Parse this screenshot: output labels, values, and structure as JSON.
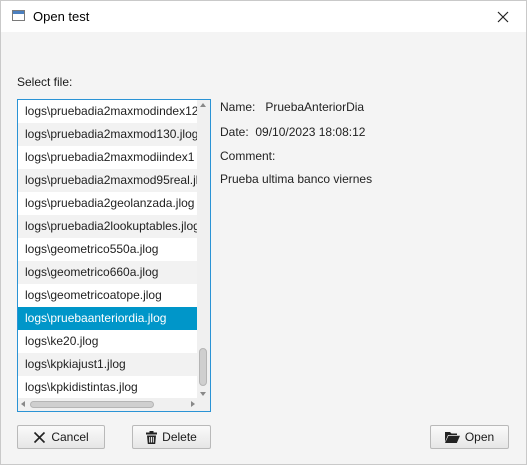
{
  "window": {
    "title": "Open test",
    "icon": "app-window-icon",
    "close_icon": "close-icon"
  },
  "select_label": "Select file:",
  "files": [
    "logs\\pruebadia2maxmodindex12",
    "logs\\pruebadia2maxmod130.jlog",
    "logs\\pruebadia2maxmodiindex1",
    "logs\\pruebadia2maxmod95real.jl",
    "logs\\pruebadia2geolanzada.jlog",
    "logs\\pruebadia2lookuptables.jlog",
    "logs\\geometrico550a.jlog",
    "logs\\geometrico660a.jlog",
    "logs\\geometricoatope.jlog",
    "logs\\pruebaanteriordia.jlog",
    "logs\\ke20.jlog",
    "logs\\kpkiajust1.jlog",
    "logs\\kpkidistintas.jlog"
  ],
  "selected_index": 9,
  "details": {
    "name_label": "Name:",
    "name_value": "PruebaAnteriorDia",
    "date_label": "Date:",
    "date_value": "09/10/2023 18:08:12",
    "comment_label": "Comment:",
    "comment_value": "Prueba ultima banco viernes"
  },
  "buttons": {
    "cancel": "Cancel",
    "delete": "Delete",
    "open": "Open"
  },
  "icons": {
    "cancel": "x-icon",
    "delete": "trash-icon",
    "open": "folder-open-icon"
  },
  "colors": {
    "selection": "#0096c9",
    "focus_border": "#2a93d5"
  }
}
